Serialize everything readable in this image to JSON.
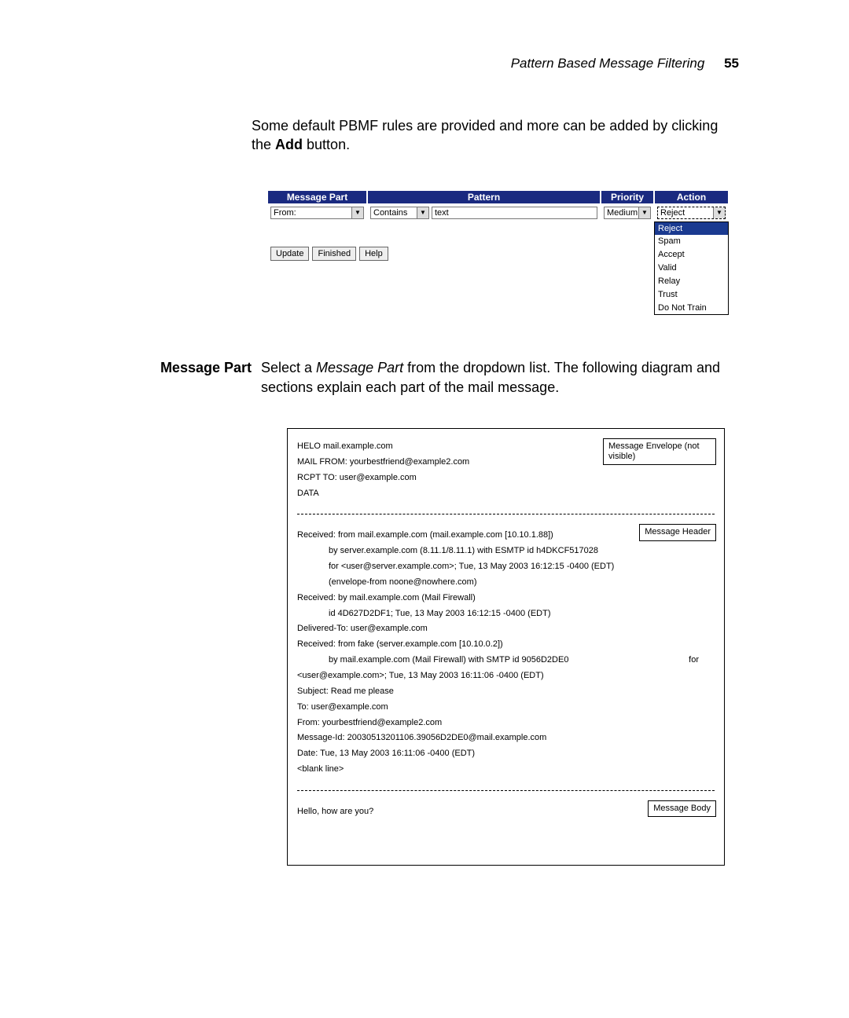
{
  "header": {
    "title": "Pattern Based Message Filtering",
    "page_number": "55"
  },
  "intro": {
    "text_before": "Some default PBMF rules are provided and more can be added by clicking the ",
    "bold_word": "Add",
    "text_after": " button."
  },
  "pbmf": {
    "headers": {
      "message_part": "Message Part",
      "pattern": "Pattern",
      "priority": "Priority",
      "action": "Action"
    },
    "row": {
      "message_part_value": "From:",
      "pattern_op": "Contains",
      "pattern_value": "text",
      "priority_value": "Medium",
      "action_value": "Reject"
    },
    "action_options": [
      "Reject",
      "Spam",
      "Accept",
      "Valid",
      "Relay",
      "Trust",
      "Do Not Train"
    ],
    "action_selected": "Reject",
    "buttons": {
      "update": "Update",
      "finished": "Finished",
      "help": "Help"
    }
  },
  "section": {
    "label": "Message Part",
    "body_before": "Select a ",
    "body_italic": "Message Part",
    "body_after": " from the dropdown list. The following diagram and sections explain each part of the mail message."
  },
  "mail": {
    "envelope": {
      "label": "Message Envelope (not visible)",
      "lines": [
        "HELO mail.example.com",
        "MAIL FROM: yourbestfriend@example2.com",
        "RCPT TO: user@example.com",
        "DATA"
      ]
    },
    "headers": {
      "label": "Message Header",
      "l1": "Received: from mail.example.com (mail.example.com [10.10.1.88])",
      "l2": "by server.example.com (8.11.1/8.11.1) with ESMTP id h4DKCF517028",
      "l3": "for <user@server.example.com>; Tue, 13 May 2003 16:12:15 -0400 (EDT)",
      "l4": "(envelope-from noone@nowhere.com)",
      "l5": "Received: by mail.example.com (Mail Firewall)",
      "l6": "id 4D627D2DF1; Tue, 13 May 2003 16:12:15 -0400 (EDT)",
      "l7": "Delivered-To: user@example.com",
      "l8": "Received: from fake (server.example.com [10.10.0.2])",
      "l9a": "by mail.example.com (Mail Firewall) with SMTP id 9056D2DE0",
      "l9b": "for",
      "l10": "<user@example.com>; Tue, 13 May 2003 16:11:06 -0400 (EDT)",
      "l11": "Subject: Read me please",
      "l12": "To: user@example.com",
      "l13": "From: yourbestfriend@example2.com",
      "l14": "Message-Id: 20030513201106.39056D2DE0@mail.example.com",
      "l15": "Date: Tue, 13 May 2003 16:11:06 -0400 (EDT)",
      "l16": "<blank line>"
    },
    "body": {
      "label": "Message Body",
      "lines": [
        "Hello, how are you?"
      ]
    }
  }
}
